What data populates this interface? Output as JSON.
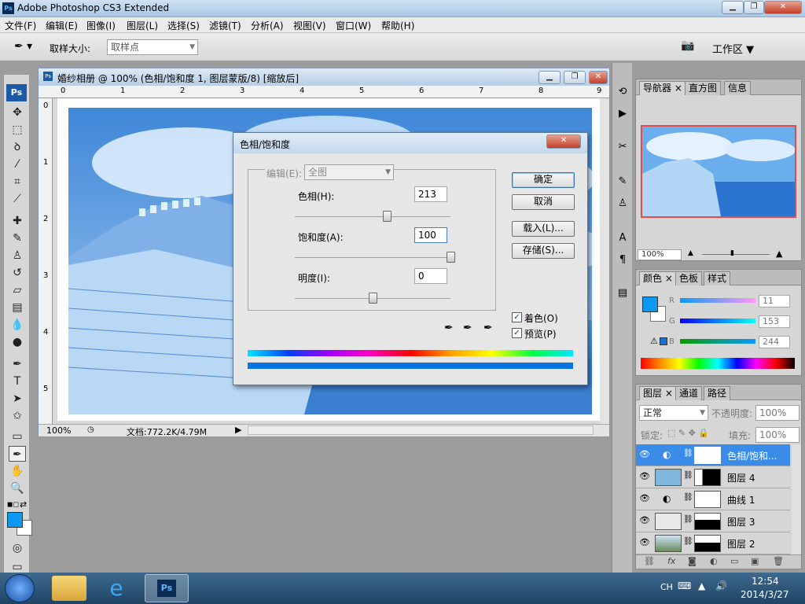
{
  "app": {
    "title": "Adobe Photoshop CS3 Extended",
    "icon_text": "Ps"
  },
  "menu": [
    "文件(F)",
    "编辑(E)",
    "图像(I)",
    "图层(L)",
    "选择(S)",
    "滤镜(T)",
    "分析(A)",
    "视图(V)",
    "窗口(W)",
    "帮助(H)"
  ],
  "options": {
    "sample_label": "取样大小:",
    "sample_value": "取样点",
    "workspace": "工作区 ▼"
  },
  "document": {
    "title": "婚纱相册 @ 100% (色相/饱和度 1, 图层蒙版/8) [缩放后]",
    "ruler_h": [
      "0",
      "1",
      "2",
      "3",
      "4",
      "5",
      "6",
      "7",
      "8",
      "9"
    ],
    "ruler_v": [
      "0",
      "1",
      "2",
      "3",
      "4",
      "5"
    ],
    "zoom": "100%",
    "doc_info": "文档:772.2K/4.79M"
  },
  "dialog": {
    "title": "色相/饱和度",
    "edit_label": "编辑(E):",
    "edit_value": "全图",
    "hue_label": "色相(H):",
    "hue_value": "213",
    "hue": 213,
    "sat_label": "饱和度(A):",
    "sat_value": "100",
    "saturation": 100,
    "light_label": "明度(I):",
    "light_value": "0",
    "lightness": 0,
    "ok": "确定",
    "cancel": "取消",
    "load": "载入(L)...",
    "save": "存储(S)...",
    "colorize": "着色(O)",
    "preview": "预览(P)"
  },
  "navigator": {
    "tabs": [
      "导航器",
      "直方图",
      "信息"
    ],
    "zoom": "100%"
  },
  "color": {
    "tabs": [
      "颜色",
      "色板",
      "样式"
    ],
    "labels": [
      "R",
      "G",
      "B"
    ],
    "values": [
      "11",
      "153",
      "244"
    ],
    "fg": "#0b99f4",
    "bg": "#ffffff"
  },
  "layers": {
    "tabs": [
      "图层",
      "通道",
      "路径"
    ],
    "blend": "正常",
    "opacity_label": "不透明度:",
    "opacity": "100%",
    "lock_label": "锁定:",
    "fill_label": "填充:",
    "fill": "100%",
    "items": [
      {
        "name": "色相/饱和..."
      },
      {
        "name": "图层 4"
      },
      {
        "name": "曲线 1"
      },
      {
        "name": "图层 3"
      },
      {
        "name": "图层 2"
      }
    ]
  },
  "tray": {
    "lang": "CH",
    "time": "12:54",
    "date": "2014/3/27"
  }
}
